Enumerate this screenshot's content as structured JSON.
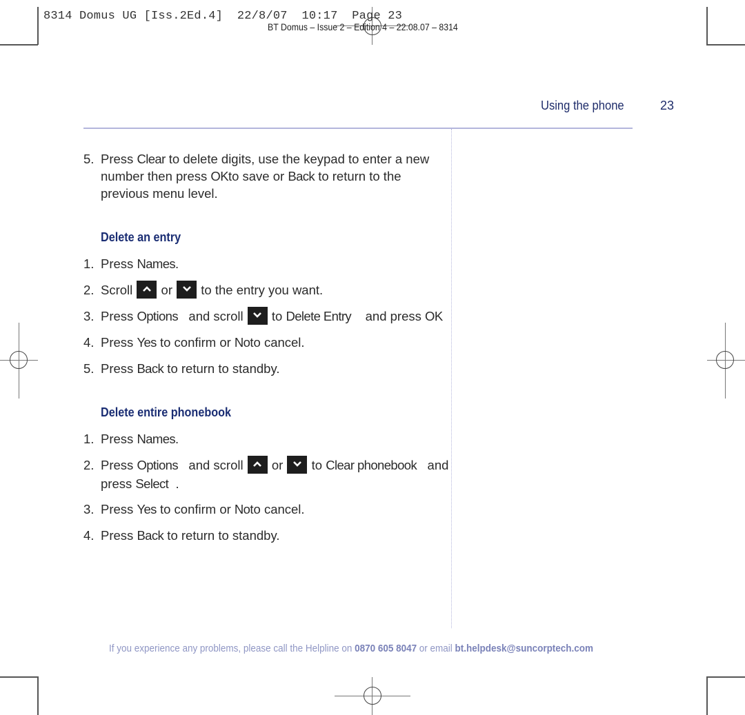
{
  "print_slug": {
    "job_line": "8314 Domus UG [Iss.2Ed.4]  22/8/07  10:17  Page 23",
    "edition_line": "BT Domus – Issue 2 – Edition 4 – 22.08.07 – 8314"
  },
  "header": {
    "section_title": "Using the phone",
    "page_number": "23"
  },
  "intro_step": {
    "number": "5.",
    "line1_a": "Press ",
    "line1_kw": "Clear",
    "line1_b": "  to delete digits, use the keypad to enter a new",
    "line2_a": "number then press ",
    "line2_kw1": "OK",
    "line2_b": "to save or ",
    "line2_kw2": "Back",
    "line2_c": " to return to the",
    "line3": "previous menu level."
  },
  "sections": [
    {
      "heading": "Delete an entry",
      "steps": [
        {
          "number": "1.",
          "a": "Press ",
          "kw1": "Names",
          "b": "."
        },
        {
          "number": "2.",
          "a": "Scroll ",
          "b": " or ",
          "c": " to the entry you want."
        },
        {
          "number": "3.",
          "a": "Press ",
          "kw1": "Options",
          "b": "   and scroll ",
          "kw2": "Delete Entry",
          "c": " to ",
          "d": "    and press ",
          "kw3": "OK"
        },
        {
          "number": "4.",
          "a": "Press ",
          "kw1": "Yes",
          "b": " to confirm or ",
          "kw2": "No",
          "c": "to cancel."
        },
        {
          "number": "5.",
          "a": "Press ",
          "kw1": "Back",
          "b": " to return to standby."
        }
      ]
    },
    {
      "heading": "Delete entire phonebook",
      "steps": [
        {
          "number": "1.",
          "a": "Press ",
          "kw1": "Names",
          "b": "."
        },
        {
          "number": "2.",
          "a": "Press ",
          "kw1": "Options",
          "b": "   and scroll ",
          "c": " or ",
          "d": " to ",
          "kw2": "Clear phonebook",
          "e": "   and",
          "line2_a": "press ",
          "kw3": "Select",
          "line2_b": "  ."
        },
        {
          "number": "3.",
          "a": "Press ",
          "kw1": "Yes",
          "b": " to confirm or ",
          "kw2": "No",
          "c": "to cancel."
        },
        {
          "number": "4.",
          "a": "Press ",
          "kw1": "Back",
          "b": " to return to standby."
        }
      ]
    }
  ],
  "icons": {
    "scroll_up": "chevron-up-key",
    "scroll_down": "chevron-down-key"
  },
  "footer": {
    "text_a": "If you experience any problems, please call the Helpline on ",
    "phone": "0870 605 8047",
    "text_b": " or email ",
    "email": "bt.helpdesk@suncorptech.com"
  },
  "colors": {
    "heading": "#1a2d73",
    "header_text": "#1f2d6b",
    "rule": "#b3b5dc",
    "footer": "#8f96c4",
    "body_text": "#2b2b2b",
    "key_bg": "#1e1e1e"
  }
}
